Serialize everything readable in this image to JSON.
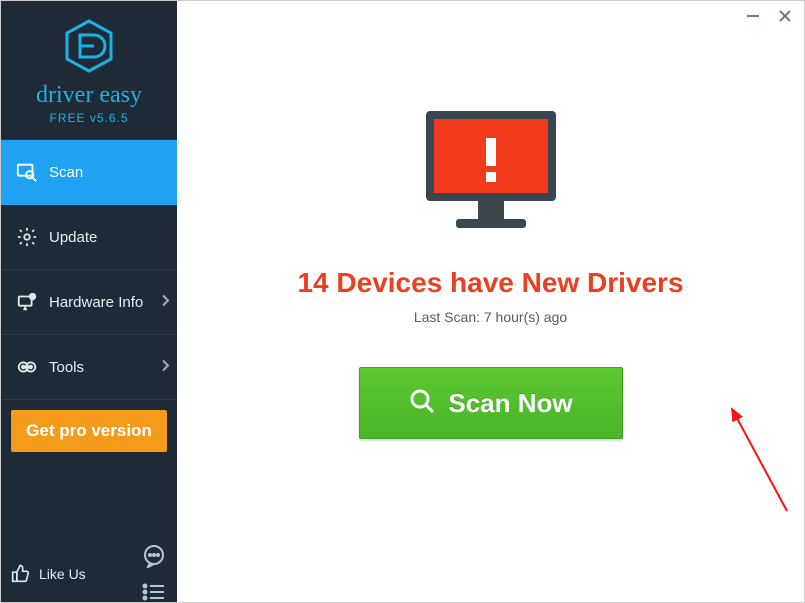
{
  "window": {
    "brand_name": "driver easy",
    "brand_sub": "FREE v5.6.5"
  },
  "sidebar": {
    "items": [
      {
        "label": "Scan",
        "icon": "scan-icon",
        "active": true,
        "has_chev": false
      },
      {
        "label": "Update",
        "icon": "gear-icon",
        "active": false,
        "has_chev": false
      },
      {
        "label": "Hardware Info",
        "icon": "hardware-icon",
        "active": false,
        "has_chev": true
      },
      {
        "label": "Tools",
        "icon": "tools-icon",
        "active": false,
        "has_chev": true
      }
    ],
    "get_pro_label": "Get pro version",
    "like_us_label": "Like Us"
  },
  "main": {
    "devices_count": 14,
    "headline_template": "14 Devices have New Drivers",
    "last_scan_label": "Last Scan: 7 hour(s) ago",
    "scan_now_label": "Scan Now"
  },
  "colors": {
    "sidebar_bg": "#1e2a36",
    "accent_blue": "#1ea2f1",
    "brand_blue": "#19b3e6",
    "pro_orange": "#f59b1b",
    "alert_red": "#e94022",
    "scan_green": "#4fbd2b"
  }
}
